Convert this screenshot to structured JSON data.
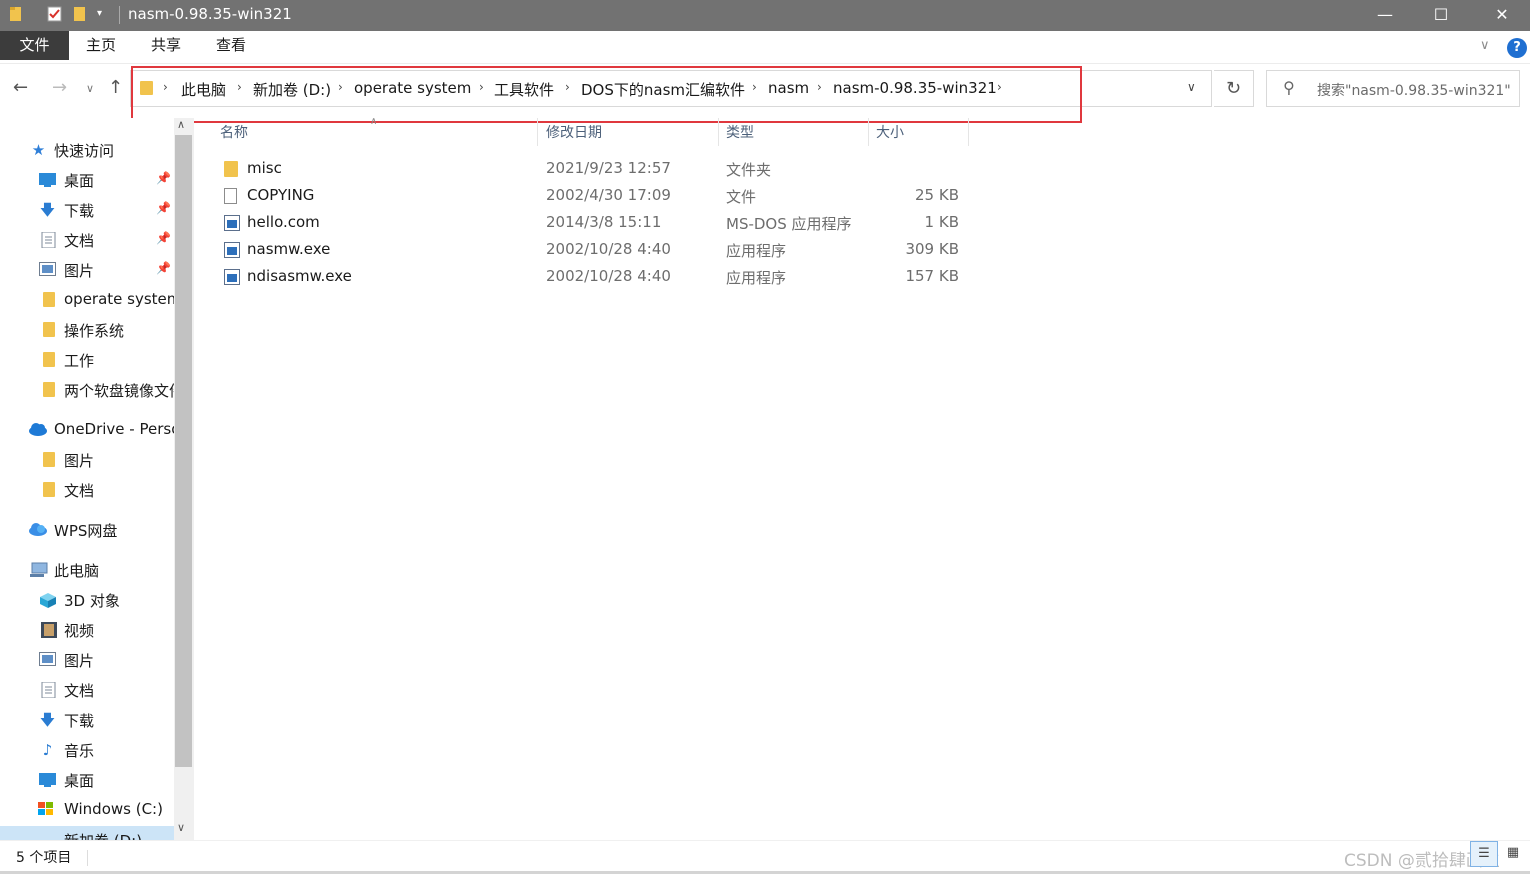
{
  "window": {
    "title": "nasm-0.98.35-win321",
    "minimize_icon": "minimize-icon",
    "maximize_icon": "maximize-icon",
    "close_icon": "close-icon"
  },
  "ribbon": {
    "tabs": [
      "文件",
      "主页",
      "共享",
      "查看"
    ],
    "active_tab_color": "#3c3c3c"
  },
  "address_bar": {
    "breadcrumbs": [
      "此电脑",
      "新加卷 (D:)",
      "operate system",
      "工具软件",
      "DOS下的nasm汇编软件",
      "nasm",
      "nasm-0.98.35-win321"
    ],
    "highlight_color": "#e0383e"
  },
  "search": {
    "placeholder": "搜索\"nasm-0.98.35-win321\""
  },
  "sidebar": {
    "quick_access": {
      "label": "快速访问",
      "items": [
        {
          "label": "桌面",
          "icon": "desktop-icon",
          "pinned": true
        },
        {
          "label": "下载",
          "icon": "download-icon",
          "pinned": true
        },
        {
          "label": "文档",
          "icon": "document-icon",
          "pinned": true
        },
        {
          "label": "图片",
          "icon": "picture-icon",
          "pinned": true
        },
        {
          "label": "operate system",
          "icon": "folder-icon",
          "pinned": false
        },
        {
          "label": "操作系统",
          "icon": "folder-icon",
          "pinned": false
        },
        {
          "label": "工作",
          "icon": "folder-icon",
          "pinned": false
        },
        {
          "label": "两个软盘镜像文件",
          "icon": "folder-icon",
          "pinned": false
        }
      ]
    },
    "onedrive": {
      "label": "OneDrive - Personal",
      "items": [
        {
          "label": "图片",
          "icon": "folder-icon"
        },
        {
          "label": "文档",
          "icon": "folder-icon"
        }
      ]
    },
    "wps": {
      "label": "WPS网盘"
    },
    "this_pc": {
      "label": "此电脑",
      "items": [
        {
          "label": "3D 对象",
          "icon": "3d-objects-icon"
        },
        {
          "label": "视频",
          "icon": "video-icon"
        },
        {
          "label": "图片",
          "icon": "picture-icon"
        },
        {
          "label": "文档",
          "icon": "document-icon"
        },
        {
          "label": "下载",
          "icon": "download-icon"
        },
        {
          "label": "音乐",
          "icon": "music-icon"
        },
        {
          "label": "桌面",
          "icon": "desktop-icon"
        },
        {
          "label": "Windows (C:)",
          "icon": "drive-icon"
        },
        {
          "label": "新加卷 (D:)",
          "icon": "drive-icon"
        }
      ]
    }
  },
  "columns": {
    "name": "名称",
    "date": "修改日期",
    "type": "类型",
    "size": "大小"
  },
  "files": [
    {
      "name": "misc",
      "date": "2021/9/23 12:57",
      "type": "文件夹",
      "size": "",
      "icon": "folder-icon"
    },
    {
      "name": "COPYING",
      "date": "2002/4/30 17:09",
      "type": "文件",
      "size": "25 KB",
      "icon": "file-icon"
    },
    {
      "name": "hello.com",
      "date": "2014/3/8 15:11",
      "type": "MS-DOS 应用程序",
      "size": "1 KB",
      "icon": "application-icon"
    },
    {
      "name": "nasmw.exe",
      "date": "2002/10/28 4:40",
      "type": "应用程序",
      "size": "309 KB",
      "icon": "application-icon"
    },
    {
      "name": "ndisasmw.exe",
      "date": "2002/10/28 4:40",
      "type": "应用程序",
      "size": "157 KB",
      "icon": "application-icon"
    }
  ],
  "status": {
    "item_count": "5 个项目",
    "watermark": "CSDN @贰拾肆画生"
  }
}
